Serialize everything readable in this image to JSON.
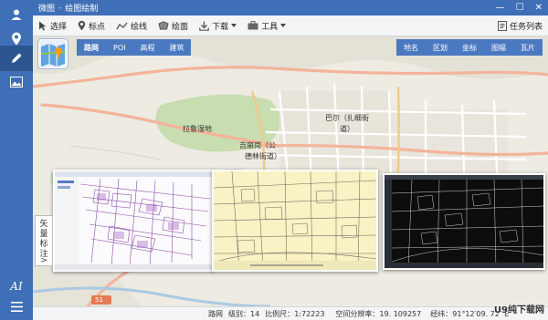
{
  "window": {
    "app_name": "微图",
    "separator": "-",
    "module_name": "绘图绘制",
    "controls": {
      "minimize": "—",
      "maximize": "☐",
      "close": "✕"
    }
  },
  "sidebar": {
    "items": [
      {
        "icon": "user-icon"
      },
      {
        "icon": "location-pin-icon"
      },
      {
        "icon": "pencil-icon",
        "active": true
      },
      {
        "icon": "image-icon"
      }
    ],
    "bottom": {
      "ai_label": "AI",
      "menu_icon": "hamburger-menu-icon"
    }
  },
  "toolbar": {
    "select": "选择",
    "marker": "标点",
    "polyline": "绘线",
    "polygon": "绘面",
    "download": "下载",
    "tools": "工具",
    "task_list": "任务列表"
  },
  "map_tabs_left": [
    "路网",
    "POI",
    "高程",
    "建筑"
  ],
  "map_tabs_right": [
    "地名",
    "区划",
    "坐标",
    "图幅",
    "瓦片"
  ],
  "map_labels": {
    "road": "拉鲁湿地",
    "district1": "吉崩岗（公",
    "district1b": "德林街道）",
    "district2": "巴尔（扎细街",
    "district2b": "道）",
    "road_num": "51"
  },
  "vector_panel": {
    "chars": [
      "矢",
      "量",
      "标",
      "注"
    ],
    "arrow": ">"
  },
  "statusbar": {
    "layer": "路网",
    "level_label": "级别：",
    "level": "14",
    "scale_label": "比例尺：",
    "scale": "1:72223",
    "resolution_label": "空间分辨率：",
    "resolution": "19. 109257",
    "coords_label": "经纬：",
    "coords": "91°12′09. 72″ E"
  },
  "watermark": "U9纯下载网",
  "colors": {
    "sidebar": "#3f6fb6",
    "tabs": "#4a79c1",
    "road_major": "#f3b49a",
    "park": "#c8ddb0"
  }
}
